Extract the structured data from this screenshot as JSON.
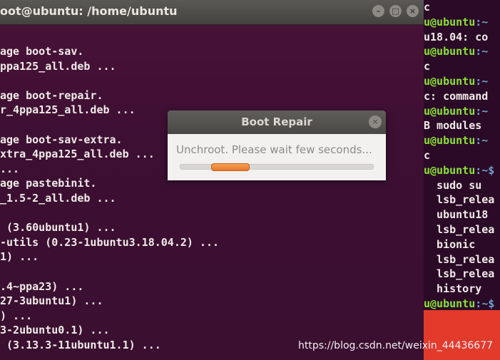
{
  "terminal": {
    "title": "oot@ubuntu: /home/ubuntu",
    "controls": [
      "–",
      "□",
      "×"
    ],
    "lines": [
      "age boot-sav.",
      "ppa125_all.deb ...",
      "",
      "age boot-repair.",
      "r_4ppa125_all.deb ...",
      "",
      "age boot-sav-extra.",
      "xtra_4ppa125_all.deb ...",
      "...",
      "age pastebinit.",
      "_1.5-2_all.deb ...",
      "",
      " (3.60ubuntu1) ...",
      "-utils (0.23-1ubuntu3.18.04.2) ...",
      "1) ...",
      "",
      ".4~ppa23) ...",
      "27-3ubuntu1) ...",
      ") ...",
      "3-2ubuntu0.1) ...",
      " (3.13.3-11ubuntu1.1) ..."
    ]
  },
  "right_terminal": {
    "lines": [
      {
        "user": "",
        "path": "",
        "text": "c"
      },
      {
        "user": "u@ubuntu",
        "path": ":~",
        "text": ""
      },
      {
        "user": "",
        "path": "",
        "text": "u18.04: co"
      },
      {
        "user": "u@ubuntu",
        "path": ":~",
        "text": ""
      },
      {
        "user": "",
        "path": "",
        "text": "c"
      },
      {
        "user": "u@ubuntu",
        "path": ":~",
        "text": ""
      },
      {
        "user": "",
        "path": "",
        "text": "c: command"
      },
      {
        "user": "u@ubuntu",
        "path": ":~",
        "text": ""
      },
      {
        "user": "",
        "path": "",
        "text": "B modules"
      },
      {
        "user": "u@ubuntu",
        "path": ":~",
        "text": ""
      },
      {
        "user": "",
        "path": "",
        "text": "c"
      },
      {
        "user": "u@ubuntu",
        "path": ":~$",
        "text": ""
      },
      {
        "user": "",
        "path": "",
        "text": "  sudo su"
      },
      {
        "user": "",
        "path": "",
        "text": "  lsb_relea"
      },
      {
        "user": "",
        "path": "",
        "text": "  ubuntu18"
      },
      {
        "user": "",
        "path": "",
        "text": "  lsb_relea"
      },
      {
        "user": "",
        "path": "",
        "text": "  bionic"
      },
      {
        "user": "",
        "path": "",
        "text": "  lsb_relea"
      },
      {
        "user": "",
        "path": "",
        "text": "  lsb_relea"
      },
      {
        "user": "",
        "path": "",
        "text": "  history"
      },
      {
        "user": "u@ubuntu",
        "path": ":~$",
        "text": ""
      }
    ]
  },
  "dialog": {
    "title": "Boot Repair",
    "close": "×",
    "message": "Unchroot. Please wait few seconds...",
    "progress_label": ""
  },
  "watermark": "https://blog.csdn.net/weixin_44436677",
  "colors": {
    "terminal_bg": "#3d0f33",
    "prompt_user": "#8ae234",
    "prompt_path": "#729fcf",
    "progress": "#e6772e",
    "red_panel": "#e23a2b"
  }
}
